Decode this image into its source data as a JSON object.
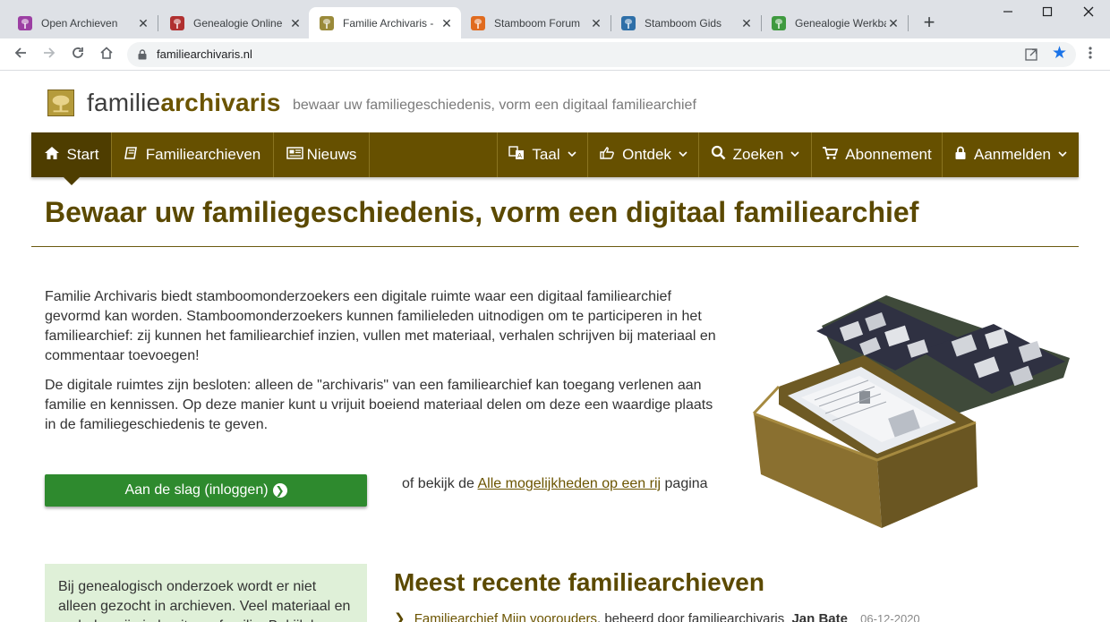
{
  "browser": {
    "tabs": [
      {
        "title": "Open Archieven",
        "fav_color": "#9c3fa3"
      },
      {
        "title": "Genealogie Online",
        "fav_color": "#b03030"
      },
      {
        "title": "Familie Archivaris - ",
        "fav_color": "#9a8a3a"
      },
      {
        "title": "Stamboom Forum",
        "fav_color": "#e06b1f"
      },
      {
        "title": "Stamboom Gids",
        "fav_color": "#2e6fa8"
      },
      {
        "title": "Genealogie Werkba",
        "fav_color": "#3f9a3f"
      }
    ],
    "close_glyph": "✕",
    "new_tab_glyph": "+",
    "url": "familiearchivaris.nl"
  },
  "site": {
    "brand_light": "familie",
    "brand_bold": "archivaris",
    "tagline": "bewaar uw familiegeschiedenis, vorm een digitaal familiearchief",
    "nav": {
      "start": "Start",
      "archives": "Familiearchieven",
      "news": "Nieuws",
      "language": "Taal",
      "discover": "Ontdek",
      "search": "Zoeken",
      "subscription": "Abonnement",
      "login": "Aanmelden"
    },
    "headline": "Bewaar uw familiegeschiedenis, vorm een digitaal familiearchief",
    "intro_p1": "Familie Archivaris biedt stamboomonderzoekers een digitale ruimte waar een digitaal familiearchief gevormd kan worden. Stamboomonderzoekers kunnen familieleden uitnodigen om te participeren in het familiearchief: zij kunnen het familiearchief inzien, vullen met materiaal, verhalen schrijven bij materiaal en commentaar toevoegen!",
    "intro_p2": "De digitale ruimtes zijn besloten: alleen de \"archivaris\" van een familiearchief kan toegang verlenen aan familie en kennissen. Op deze manier kunt u vrijuit boeiend materiaal delen om deze een waardige plaats in de familiegeschiedenis te geven.",
    "cta_label": "Aan de slag (inloggen)",
    "alt_prefix": "of bekijk de",
    "alt_link": "Alle mogelijkheden op een rij",
    "alt_suffix": "pagina",
    "note": "Bij genealogisch onderzoek wordt er niet alleen gezocht in archieven. Veel materiaal en verhalen zijn in bezit van familie. Bekijk hoe...",
    "recent_title": "Meest recente familiearchieven",
    "recent_item": {
      "link": "Familiearchief Mijn voorouders",
      "middle": ", beheerd door familiearchivaris",
      "who": "Jan Bate",
      "date": "06-12-2020"
    }
  }
}
